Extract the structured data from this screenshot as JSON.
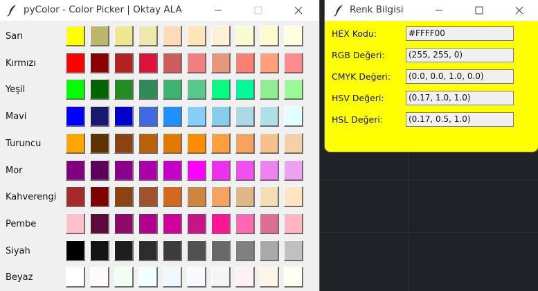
{
  "main_window": {
    "title": "pyColor - Color Picker | Oktay ALA",
    "rows": [
      {
        "label": "Sarı",
        "colors": [
          "#ffff00",
          "#bdb76b",
          "#f0e68c",
          "#eee8aa",
          "#ffdab9",
          "#ffe4b5",
          "#ffefd5",
          "#fafad2",
          "#fffacd",
          "#ffffe0"
        ]
      },
      {
        "label": "Kırmızı",
        "colors": [
          "#ff0000",
          "#8b0000",
          "#b22222",
          "#dc143c",
          "#cd5c5c",
          "#f08080",
          "#e9967a",
          "#fa8072",
          "#ffa07a",
          "#ff8c8c"
        ]
      },
      {
        "label": "Yeşil",
        "colors": [
          "#00ff00",
          "#006400",
          "#228b22",
          "#2e8b57",
          "#3cb371",
          "#57c98b",
          "#00ff7f",
          "#00fa9a",
          "#90ee90",
          "#98fb98"
        ]
      },
      {
        "label": "Mavi",
        "colors": [
          "#0000ff",
          "#191970",
          "#0000cd",
          "#4169e1",
          "#1e90ff",
          "#87cefa",
          "#87ceeb",
          "#add8e6",
          "#b0e0e6",
          "#e0ffff"
        ]
      },
      {
        "label": "Turuncu",
        "colors": [
          "#ffa500",
          "#5e3300",
          "#8b4513",
          "#b8600a",
          "#e07b00",
          "#ff8c00",
          "#ffa040",
          "#f4a460",
          "#f6c08a",
          "#f5cfa7"
        ]
      },
      {
        "label": "Mor",
        "colors": [
          "#800080",
          "#5c005c",
          "#8b008b",
          "#aa00aa",
          "#c600c6",
          "#ff00ff",
          "#ee30ee",
          "#f050f0",
          "#ee82ee",
          "#f0a0f0"
        ]
      },
      {
        "label": "Kahverengi",
        "colors": [
          "#a52a2a",
          "#800000",
          "#8b4513",
          "#a0522d",
          "#d2691e",
          "#cd853f",
          "#f4a460",
          "#deb887",
          "#f5deb3",
          "#ffe4c4"
        ]
      },
      {
        "label": "Pembe",
        "colors": [
          "#ffc0cb",
          "#5c0a3a",
          "#8b0a6a",
          "#b3008a",
          "#d0009c",
          "#c71585",
          "#ff1493",
          "#ff69b4",
          "#db7093",
          "#ffb6c1"
        ]
      },
      {
        "label": "Siyah",
        "colors": [
          "#000000",
          "#141414",
          "#1e1e1e",
          "#2d2d2d",
          "#3c3c3c",
          "#505050",
          "#696969",
          "#808080",
          "#a9a9a9",
          "#c0c0c0"
        ]
      },
      {
        "label": "Beyaz",
        "colors": [
          "#ffffff",
          "#fffafa",
          "#f0fff0",
          "#f0ffff",
          "#f0f8ff",
          "#f8f8ff",
          "#f5f5f5",
          "#fff0f5",
          "#fdf5e6",
          "#fffff0"
        ]
      }
    ]
  },
  "info_window": {
    "title": "Renk Bilgisi",
    "background": "#ffff00",
    "fields": [
      {
        "label": "HEX Kodu:",
        "value": "#FFFF00"
      },
      {
        "label": "RGB Değeri:",
        "value": "(255, 255, 0)"
      },
      {
        "label": "CMYK Değeri:",
        "value": "(0.0, 0.0, 1.0, 0.0)"
      },
      {
        "label": "HSV Değeri:",
        "value": "(0.17, 1.0, 1.0)"
      },
      {
        "label": "HSL Değeri:",
        "value": "(0.17, 0.5, 1.0)"
      }
    ]
  },
  "icons": {
    "app": "feather-icon",
    "minimize": "minimize-icon",
    "maximize": "maximize-icon",
    "close": "close-icon"
  }
}
